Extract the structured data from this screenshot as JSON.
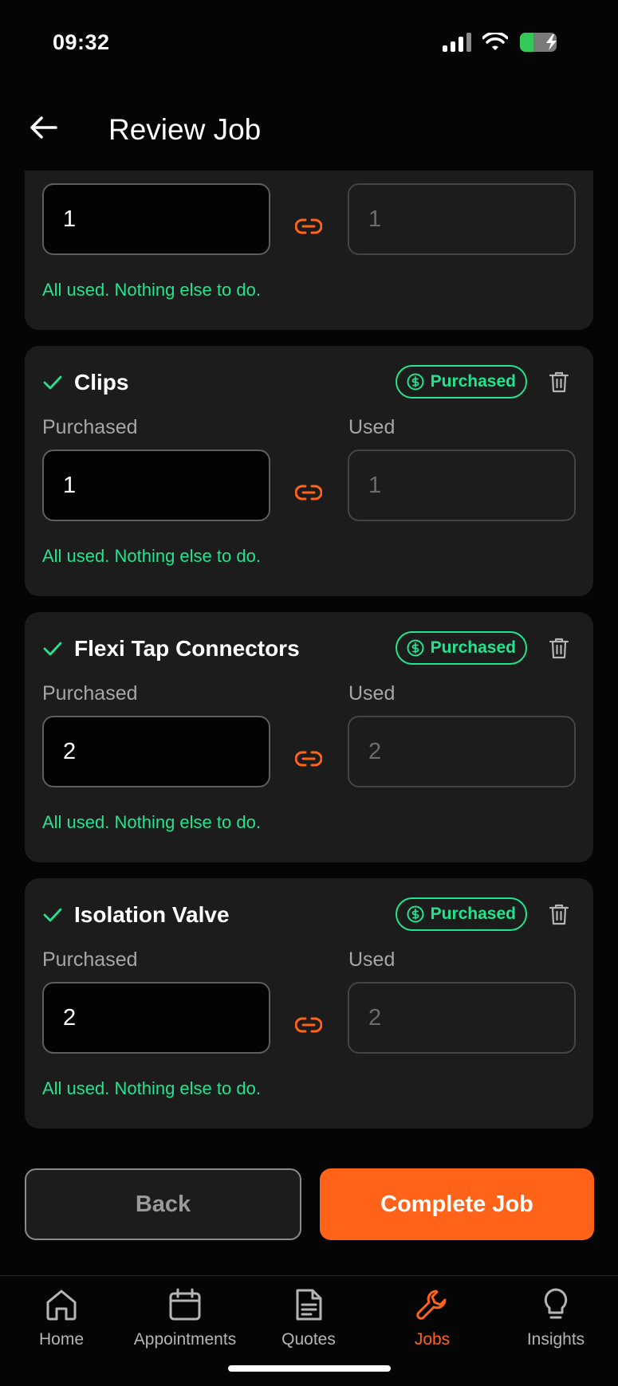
{
  "status": {
    "time": "09:32"
  },
  "header": {
    "title": "Review Job"
  },
  "cards": [
    {
      "title": "",
      "purchased_label": "",
      "used_label": "",
      "purchased_value": "1",
      "used_value": "1",
      "message": "All used. Nothing else to do."
    },
    {
      "title": "Clips",
      "badge": "Purchased",
      "purchased_label": "Purchased",
      "used_label": "Used",
      "purchased_value": "1",
      "used_value": "1",
      "message": "All used. Nothing else to do."
    },
    {
      "title": "Flexi Tap Connectors",
      "badge": "Purchased",
      "purchased_label": "Purchased",
      "used_label": "Used",
      "purchased_value": "2",
      "used_value": "2",
      "message": "All used. Nothing else to do."
    },
    {
      "title": "Isolation Valve",
      "badge": "Purchased",
      "purchased_label": "Purchased",
      "used_label": "Used",
      "purchased_value": "2",
      "used_value": "2",
      "message": "All used. Nothing else to do."
    }
  ],
  "actions": {
    "back": "Back",
    "complete": "Complete Job"
  },
  "tabs": [
    {
      "label": "Home",
      "icon": "home-icon"
    },
    {
      "label": "Appointments",
      "icon": "calendar-icon"
    },
    {
      "label": "Quotes",
      "icon": "document-icon"
    },
    {
      "label": "Jobs",
      "icon": "wrench-icon",
      "active": true
    },
    {
      "label": "Insights",
      "icon": "lightbulb-icon"
    }
  ],
  "colors": {
    "accent": "#ff6319",
    "success": "#23e38f",
    "card": "#1c1c1c",
    "background": "#050505"
  }
}
